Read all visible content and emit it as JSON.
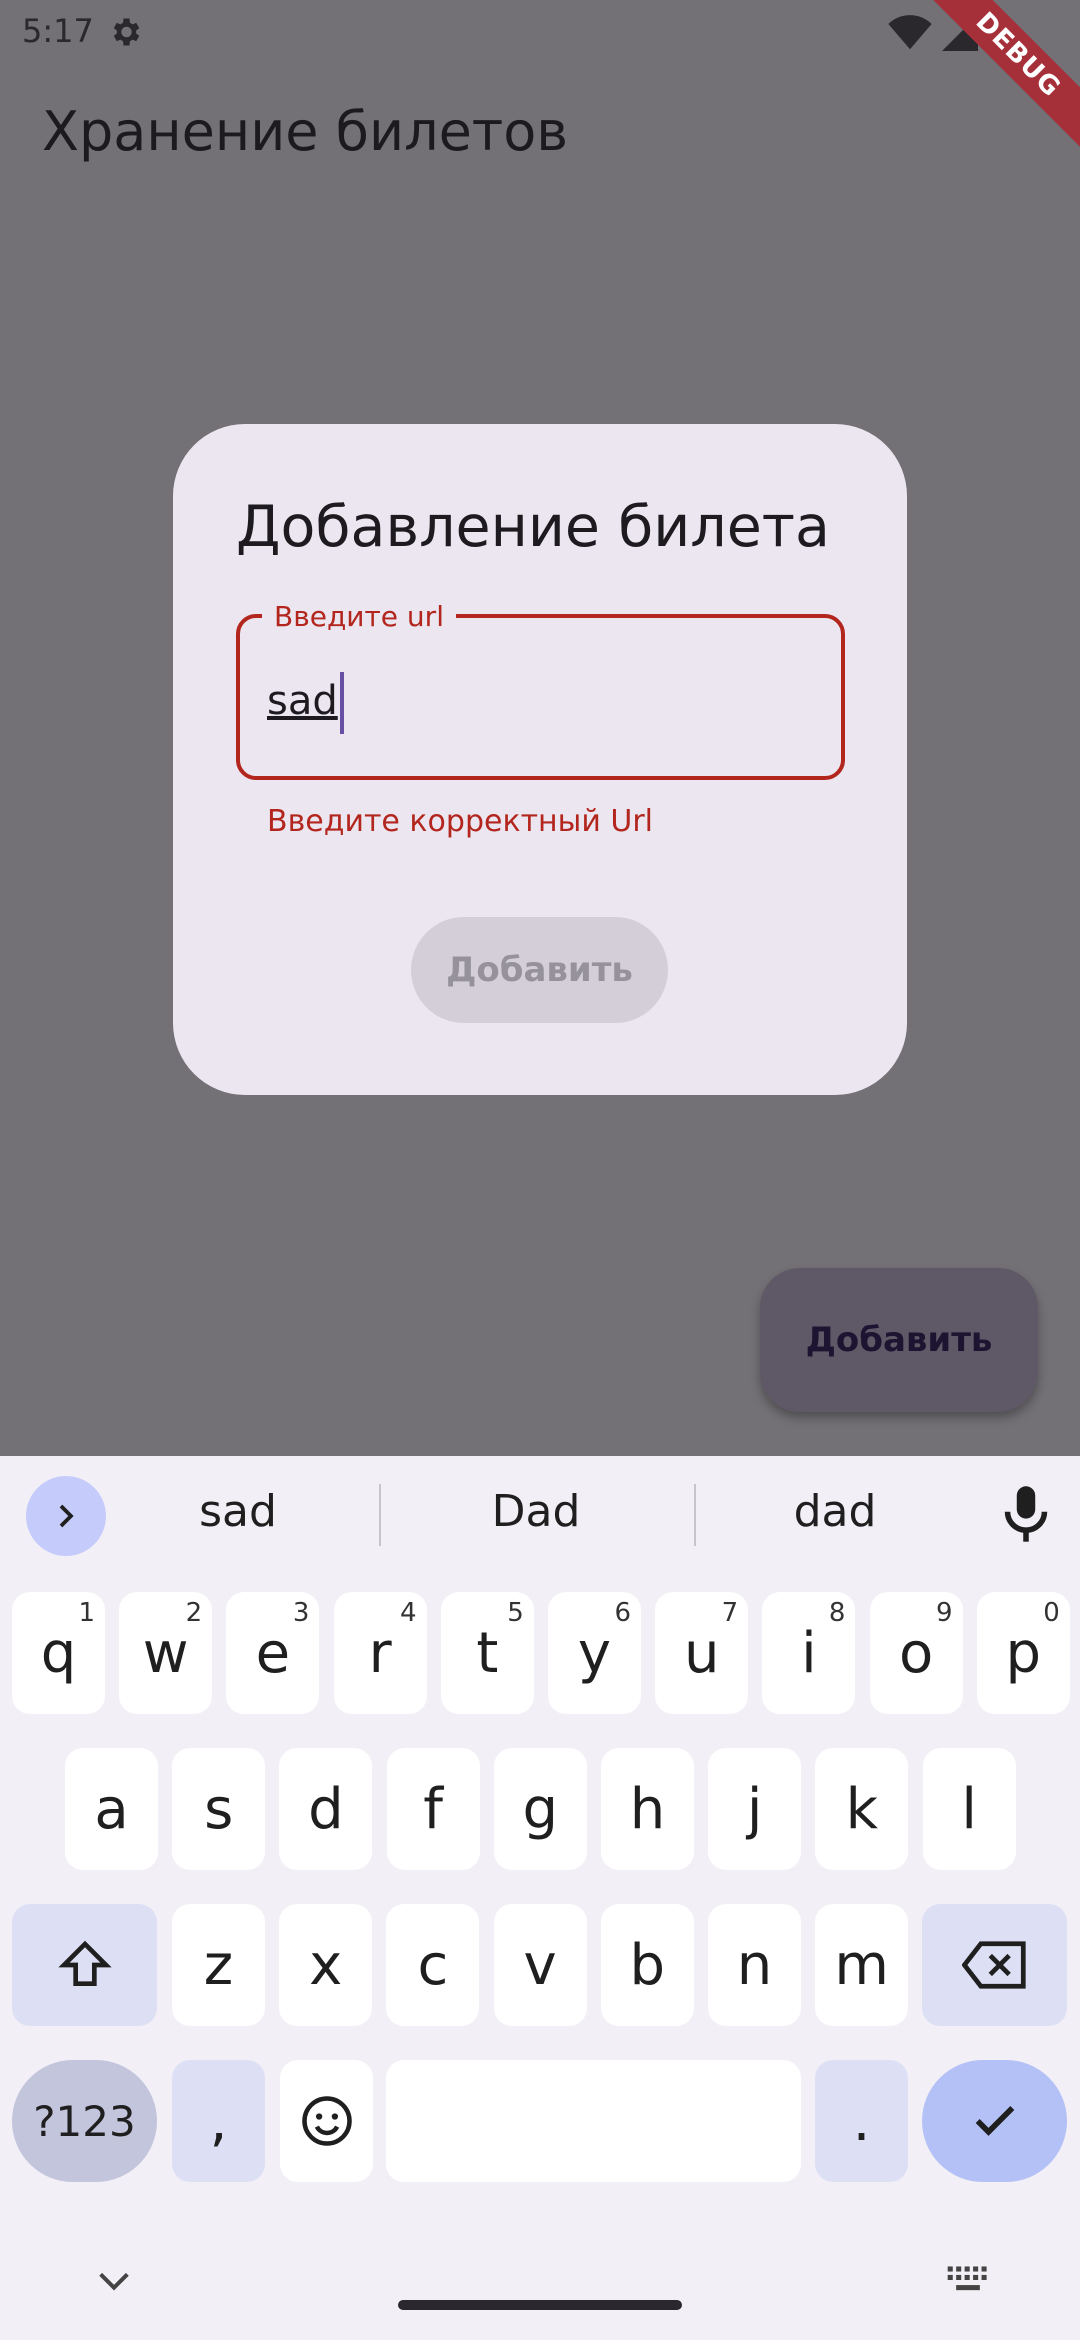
{
  "status_bar": {
    "time": "5:17",
    "icons": [
      "settings-icon",
      "wifi-icon",
      "signal-icon",
      "battery-icon"
    ]
  },
  "debug_banner": {
    "label": "DEBUG"
  },
  "app_bar": {
    "title": "Хранение билетов"
  },
  "dialog": {
    "title": "Добавление билета",
    "field": {
      "label": "Введите url",
      "value": "sad",
      "error": "Введите корректный Url"
    },
    "add_button": "Добавить"
  },
  "fab": {
    "label": "Добавить"
  },
  "keyboard": {
    "suggestions": [
      "sad",
      "Dad",
      "dad"
    ],
    "row1": [
      {
        "key": "q",
        "hint": "1"
      },
      {
        "key": "w",
        "hint": "2"
      },
      {
        "key": "e",
        "hint": "3"
      },
      {
        "key": "r",
        "hint": "4"
      },
      {
        "key": "t",
        "hint": "5"
      },
      {
        "key": "y",
        "hint": "6"
      },
      {
        "key": "u",
        "hint": "7"
      },
      {
        "key": "i",
        "hint": "8"
      },
      {
        "key": "o",
        "hint": "9"
      },
      {
        "key": "p",
        "hint": "0"
      }
    ],
    "row2": [
      "a",
      "s",
      "d",
      "f",
      "g",
      "h",
      "j",
      "k",
      "l"
    ],
    "row3": [
      "z",
      "x",
      "c",
      "v",
      "b",
      "n",
      "m"
    ],
    "symbols_key": "?123",
    "comma_key": ",",
    "period_key": "."
  },
  "colors": {
    "error": "#b3261e",
    "dialog_bg": "#ece6f0",
    "scrim": "#737175",
    "accent": "#6750a4"
  }
}
